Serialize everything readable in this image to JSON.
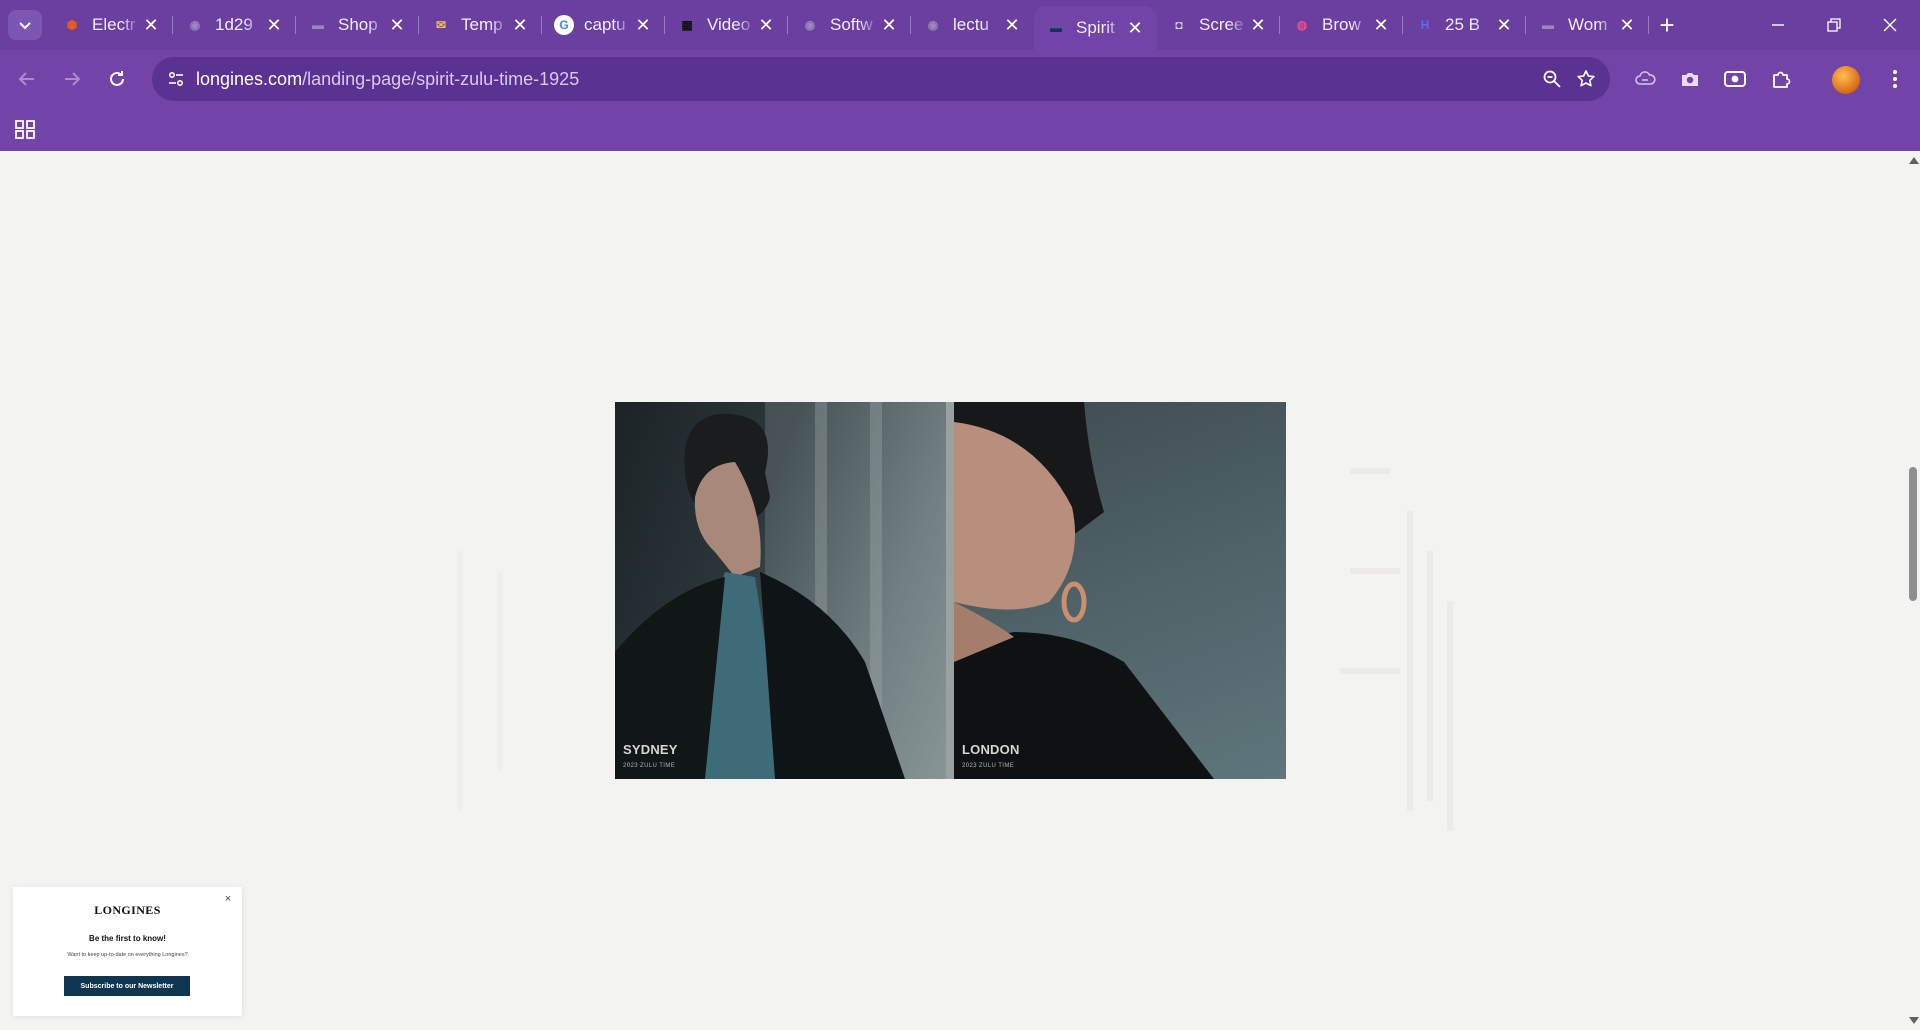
{
  "browser": {
    "tabs": [
      {
        "title": "Electr",
        "favicon": "electron-icon",
        "color": "#e55b1e"
      },
      {
        "title": "1d29",
        "favicon": "globe-icon",
        "color": "#9c86bd"
      },
      {
        "title": "Shop",
        "favicon": "shop-icon",
        "color": "#9c86bd"
      },
      {
        "title": "Temp",
        "favicon": "envelope-icon",
        "color": "#f2c15a"
      },
      {
        "title": "captu",
        "favicon": "google-icon",
        "color": "#ffffff"
      },
      {
        "title": "Video",
        "favicon": "film-icon",
        "color": "#111111"
      },
      {
        "title": "Softw",
        "favicon": "globe-icon",
        "color": "#9c86bd"
      },
      {
        "title": "lectu",
        "favicon": "globe-icon",
        "color": "#9c86bd"
      },
      {
        "title": "Spirit",
        "favicon": "longines-icon",
        "color": "#0f3550",
        "active": true
      },
      {
        "title": "Scree",
        "favicon": "camera-icon",
        "color": "#d8d8d8"
      },
      {
        "title": "Brow",
        "favicon": "dribbble-icon",
        "color": "#ea4c89"
      },
      {
        "title": "25 B",
        "favicon": "h-icon",
        "color": "#5a6cf0"
      },
      {
        "title": "Wom",
        "favicon": "shop-icon",
        "color": "#9c86bd"
      }
    ],
    "close_glyph": "✕",
    "new_tab_glyph": "+",
    "url_host": "longines.com",
    "url_path": "/landing-page/spirit-zulu-time-1925"
  },
  "video": {
    "left": {
      "city": "SYDNEY",
      "sub": "2023 ZULU TIME"
    },
    "right": {
      "city": "LONDON",
      "sub": "2023 ZULU TIME"
    }
  },
  "newsletter": {
    "logo": "LONGINES",
    "close": "×",
    "title": "Be the first to know!",
    "text": "Want to keep up-to-date on everything Longines?",
    "button": "Subscribe to our Newsletter"
  },
  "colors": {
    "tab_strip": "#6a3fa0",
    "toolbar": "#7244a8",
    "page_bg": "#f3f3f1",
    "newsletter_button": "#0f3550"
  }
}
